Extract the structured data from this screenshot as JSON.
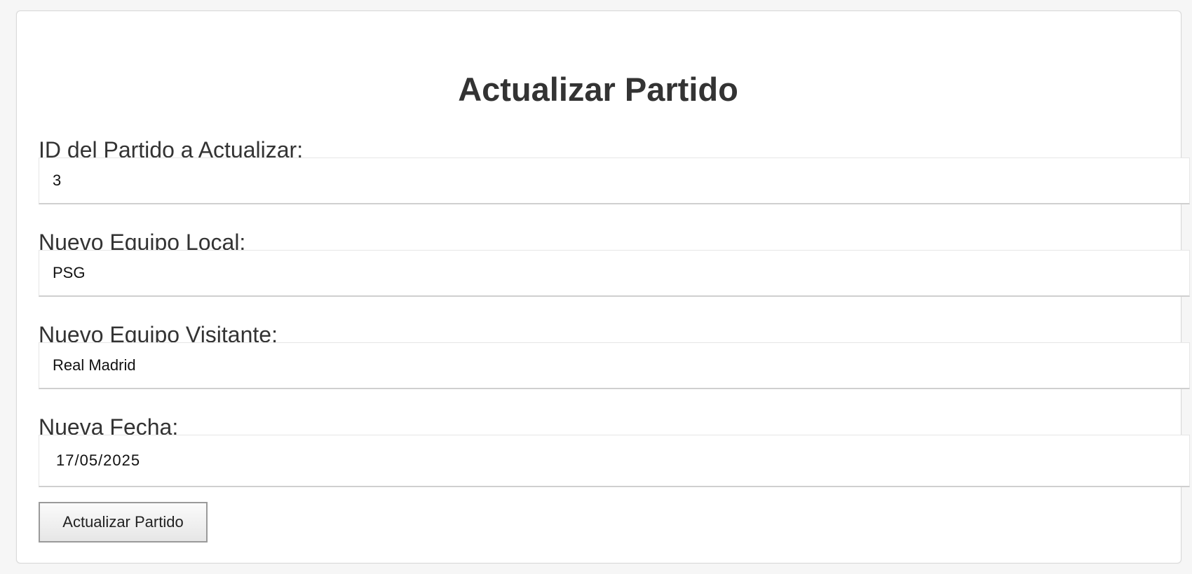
{
  "form": {
    "title": "Actualizar Partido",
    "fields": [
      {
        "label": "ID del Partido a Actualizar:",
        "value": "3"
      },
      {
        "label": "Nuevo Equipo Local:",
        "value": "PSG"
      },
      {
        "label": "Nuevo Equipo Visitante:",
        "value": "Real Madrid"
      },
      {
        "label": "Nueva Fecha:",
        "value": "17/05/2025"
      }
    ],
    "submit_label": "Actualizar Partido"
  }
}
